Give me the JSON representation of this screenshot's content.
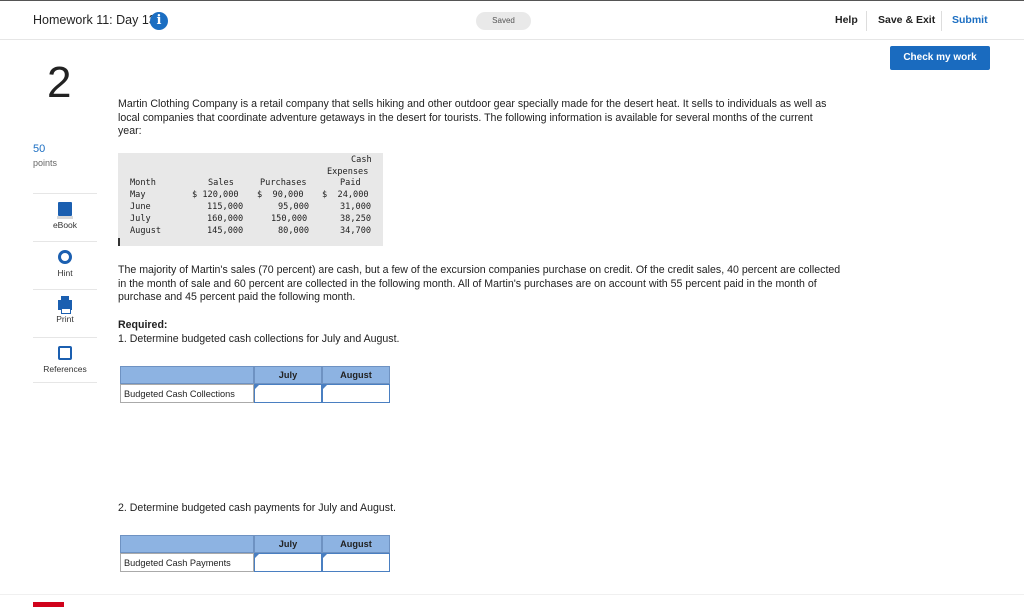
{
  "header": {
    "title": "Homework 11: Day 13",
    "saved": "Saved",
    "help": "Help",
    "save_exit": "Save & Exit",
    "submit": "Submit"
  },
  "check_button": "Check my work",
  "question": {
    "number": "2",
    "points": "50",
    "points_label": "points"
  },
  "tools": [
    {
      "label": "eBook",
      "icon": "ebook-icon"
    },
    {
      "label": "Hint",
      "icon": "hint-icon"
    },
    {
      "label": "Print",
      "icon": "print-icon"
    },
    {
      "label": "References",
      "icon": "references-icon"
    }
  ],
  "intro": "Martin Clothing Company is a retail company that sells hiking and other outdoor gear specially made for the desert heat. It sells to individuals as well as local companies that coordinate adventure getaways in the desert for tourists. The following information is available for several months of the current year:",
  "data_table": {
    "headers": {
      "month": "Month",
      "sales": "Sales",
      "purchases": "Purchases",
      "cash_line1": "Cash",
      "cash_line2": "Expenses",
      "cash_line3": "Paid"
    },
    "rows": [
      {
        "month": "May",
        "sales": "$ 120,000",
        "purchases": "$  90,000",
        "cash": "$  24,000"
      },
      {
        "month": "June",
        "sales": "115,000",
        "purchases": "95,000",
        "cash": "31,000"
      },
      {
        "month": "July",
        "sales": "160,000",
        "purchases": "150,000",
        "cash": "38,250"
      },
      {
        "month": "August",
        "sales": "145,000",
        "purchases": "80,000",
        "cash": "34,700"
      }
    ]
  },
  "body": "The majority of Martin's sales (70 percent) are cash, but a few of the excursion companies purchase on credit. Of the credit sales, 40 percent are collected in the month of sale and 60 percent are collected in the following month. All of Martin's purchases are on account with 55 percent paid in the month of purchase and 45 percent paid the following month.",
  "required": {
    "heading": "Required:",
    "item1": "1. Determine budgeted cash collections for July and August.",
    "item2": "2. Determine budgeted cash payments for July and August."
  },
  "table1": {
    "col1": "July",
    "col2": "August",
    "row_label": "Budgeted Cash Collections",
    "july_value": "",
    "august_value": ""
  },
  "table2": {
    "col1": "July",
    "col2": "August",
    "row_label": "Budgeted Cash Payments",
    "july_value": "",
    "august_value": ""
  }
}
